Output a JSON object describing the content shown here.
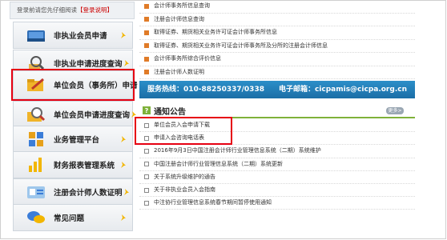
{
  "login_tip": {
    "text": "登录前请您先仔细阅读",
    "link": "【登录说明】"
  },
  "sidebar": {
    "items": [
      {
        "label": "非执业会员申请",
        "icon": "book-icon"
      },
      {
        "label": "非执业申请进度查询",
        "icon": "magnifier-icon"
      },
      {
        "label": "单位会员（事务所）申请",
        "icon": "pencil-folder-icon"
      },
      {
        "label": "单位会员申请进度查询",
        "icon": "magnifier-folder-icon"
      },
      {
        "label": "业务管理平台",
        "icon": "grid-icon"
      },
      {
        "label": "财务报表管理系统",
        "icon": "bar-chart-icon"
      },
      {
        "label": "注册会计师人数证明",
        "icon": "id-card-icon"
      },
      {
        "label": "常见问题",
        "icon": "speech-bubbles-icon"
      }
    ]
  },
  "news": {
    "items": [
      "会计师事务所信息查询",
      "注册会计师信息查询",
      "取得证券、期货相关业务许可证会计师事务所信息",
      "取得证券、期货相关业务许可证会计师事务所及分所的注册会计师信息",
      "会计师事务所综合评价信息",
      "注册会计师人数证明"
    ]
  },
  "hotline": {
    "text": "服务热线：010-88250337/0338　　电子邮箱：cicpamis@cicpa.org.cn"
  },
  "notices": {
    "title": "通知公告",
    "more": "更多>",
    "items": [
      "单位会员入会申请下载",
      "申请入会咨询电话表",
      "2016年9月3日中国注册会计师行业管理信息系统（二期）系统维护",
      "中国注册会计师行业管理信息系统（二期）系统更新",
      "关于系统升级维护的通告",
      "关于非执业会员入会指南",
      "中注协行业管理信息系统春节期间暂停使用通知"
    ]
  },
  "colors": {
    "highlight": "#e60012",
    "hotline": "#1f78b4",
    "accent": "#7fb13a"
  }
}
